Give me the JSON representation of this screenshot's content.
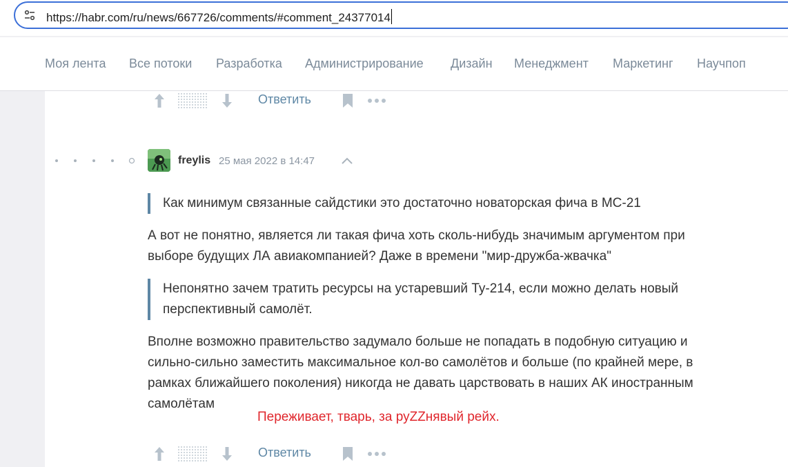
{
  "browser": {
    "url": "https://habr.com/ru/news/667726/comments/#comment_24377014",
    "site_icon": "tune-icon"
  },
  "nav": {
    "items": [
      {
        "label": "Моя лента"
      },
      {
        "label": "Все потоки"
      },
      {
        "label": "Разработка"
      },
      {
        "label": "Администрирование"
      },
      {
        "label": "Дизайн"
      },
      {
        "label": "Менеджмент"
      },
      {
        "label": "Маркетинг"
      },
      {
        "label": "Научпоп"
      }
    ]
  },
  "top_actions": {
    "reply_label": "Ответить"
  },
  "comment": {
    "username": "freylis",
    "datetime": "25 мая 2022 в 14:47",
    "quote1": "Как минимум связанные сайдстики это достаточно новаторская фича в МС-21",
    "para1": [
      "А вот не понятно, является ли такая фича хоть сколь-нибудь значимым аргументом при",
      "выборе будущих ЛА авиакомпанией? Даже в времени \"мир-дружба-жвачка\""
    ],
    "quote2": [
      "Непонятно зачем тратить ресурсы на устаревший Ту-214, если можно делать новый",
      "перспективный самолёт."
    ],
    "para2": [
      "Вполне возможно правительство задумало больше не попадать в подобную ситуацию и",
      "сильно-сильно заместить максимальное кол-во самолётов и больше (по крайней мере, в",
      "рамках ближайшего поколения) никогда не давать царствовать в наших АК иностранным",
      "самолётам"
    ],
    "reply_label": "Ответить"
  },
  "annotation": "Переживает, тварь, за руZZнявый рейх.",
  "colors": {
    "accent": "#5e87a5",
    "nav_text": "#7b8a99",
    "annotation": "#e0262c",
    "url_border": "#3b6fd8"
  }
}
